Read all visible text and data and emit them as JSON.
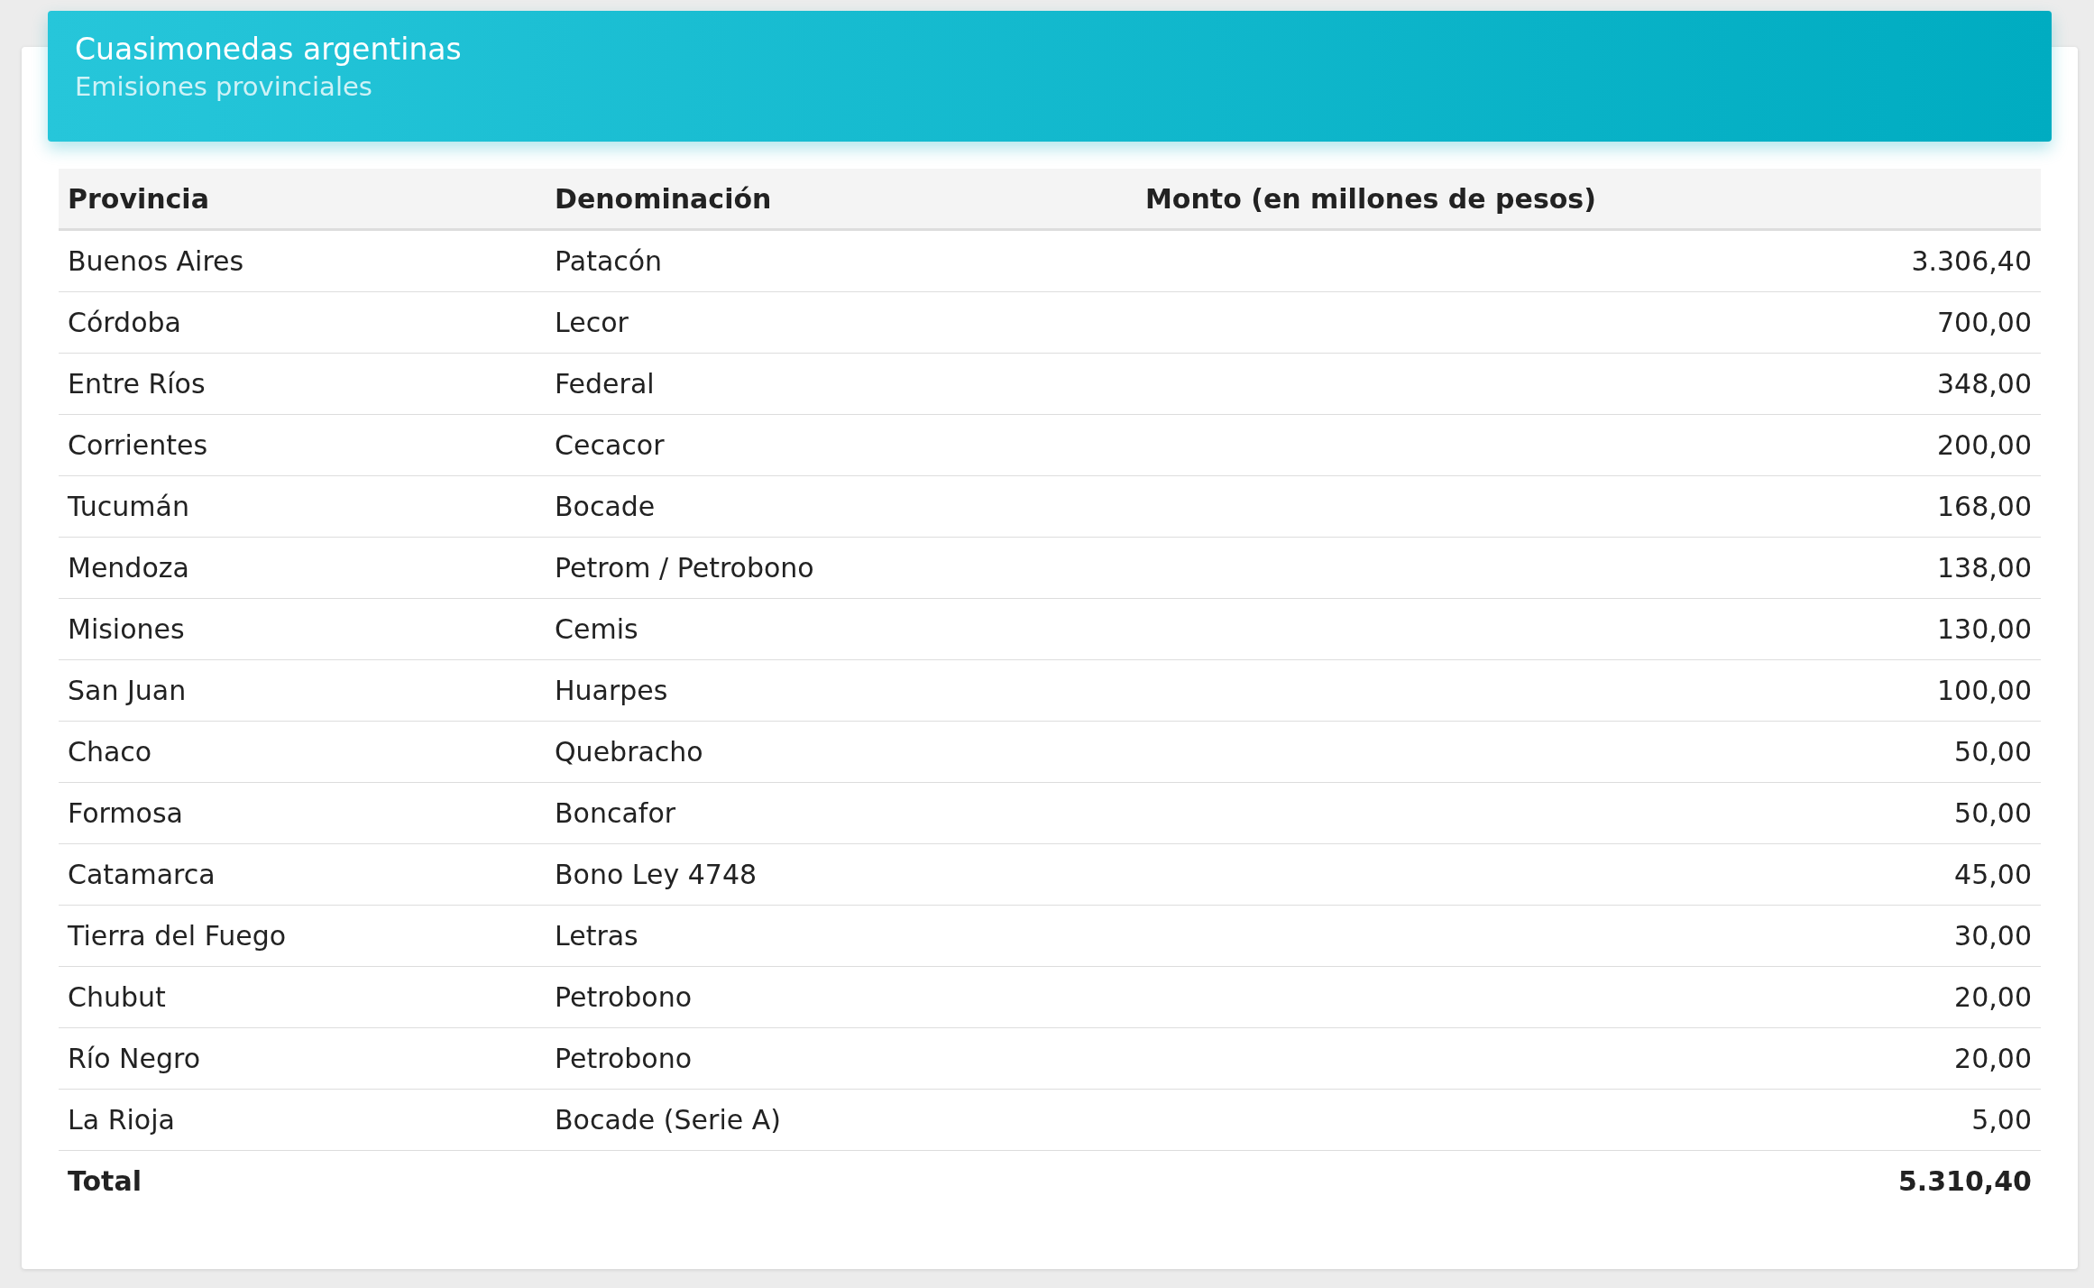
{
  "card": {
    "title": "Cuasimonedas argentinas",
    "subtitle": "Emisiones provinciales"
  },
  "table": {
    "columns": [
      "Provincia",
      "Denominación",
      "Monto (en millones de pesos)"
    ],
    "rows": [
      {
        "provincia": "Buenos Aires",
        "denominacion": "Patacón",
        "monto": "3.306,40"
      },
      {
        "provincia": "Córdoba",
        "denominacion": "Lecor",
        "monto": "700,00"
      },
      {
        "provincia": "Entre Ríos",
        "denominacion": "Federal",
        "monto": "348,00"
      },
      {
        "provincia": "Corrientes",
        "denominacion": "Cecacor",
        "monto": "200,00"
      },
      {
        "provincia": "Tucumán",
        "denominacion": "Bocade",
        "monto": "168,00"
      },
      {
        "provincia": "Mendoza",
        "denominacion": "Petrom / Petrobono",
        "monto": "138,00"
      },
      {
        "provincia": "Misiones",
        "denominacion": "Cemis",
        "monto": "130,00"
      },
      {
        "provincia": "San Juan",
        "denominacion": "Huarpes",
        "monto": "100,00"
      },
      {
        "provincia": "Chaco",
        "denominacion": "Quebracho",
        "monto": "50,00"
      },
      {
        "provincia": "Formosa",
        "denominacion": "Boncafor",
        "monto": "50,00"
      },
      {
        "provincia": "Catamarca",
        "denominacion": "Bono Ley 4748",
        "monto": "45,00"
      },
      {
        "provincia": "Tierra del Fuego",
        "denominacion": "Letras",
        "monto": "30,00"
      },
      {
        "provincia": "Chubut",
        "denominacion": "Petrobono",
        "monto": "20,00"
      },
      {
        "provincia": "Río Negro",
        "denominacion": "Petrobono",
        "monto": "20,00"
      },
      {
        "provincia": "La Rioja",
        "denominacion": "Bocade (Serie A)",
        "monto": "5,00"
      }
    ],
    "total": {
      "label": "Total",
      "monto": "5.310,40"
    }
  }
}
